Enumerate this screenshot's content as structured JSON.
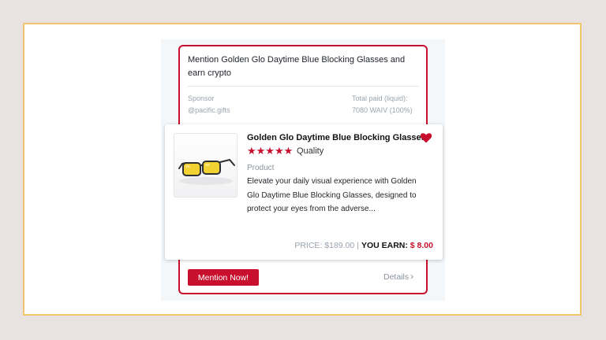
{
  "campaign": {
    "title": "Mention Golden Glo Daytime Blue Blocking Glasses and earn crypto",
    "sponsor_label": "Sponsor",
    "sponsor_value": "@pacific.gifts",
    "total_paid_label": "Total paid (liquid):",
    "total_paid_value": "7080 WAIV (100%)"
  },
  "product": {
    "title": "Golden Glo Daytime Blue Blocking Glasses",
    "rating_stars": 5,
    "stars_text": "★★★★★",
    "rating_label": "Quality",
    "type": "Product",
    "description": "Elevate your daily visual experience with Golden Glo Daytime Blue Blocking Glasses, designed to protect your eyes from the adverse...",
    "price_text": "PRICE: $189.00",
    "separator": "|",
    "earn_label": "YOU EARN:",
    "earn_value": "$ 8.00",
    "image_icon": "glasses-icon",
    "favorite_icon": "heart-icon"
  },
  "actions": {
    "mention_label": "Mention Now!",
    "details_label": "Details"
  },
  "colors": {
    "accent": "#c8102e",
    "frame_border": "#f1c56c",
    "muted_text": "#9aa3ad"
  }
}
